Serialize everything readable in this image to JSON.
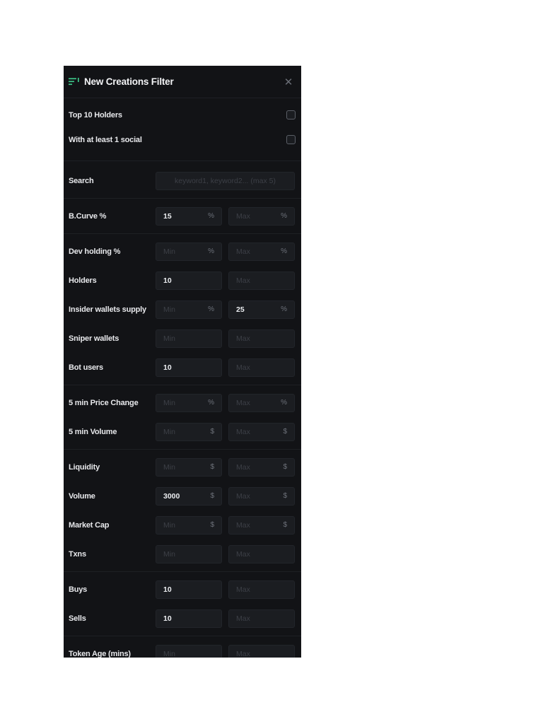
{
  "header": {
    "title": "New Creations Filter",
    "icon": "filter-lines-icon",
    "close_symbol": "✕",
    "accent": "#3ecf8e"
  },
  "checkboxes": [
    {
      "label": "Top 10 Holders",
      "checked": false
    },
    {
      "label": "With at least 1 social",
      "checked": false
    }
  ],
  "search": {
    "label": "Search",
    "placeholder": "keyword1, keyword2... (max 5)"
  },
  "bcurve": {
    "label": "B.Curve %",
    "min": "15",
    "max_ph": "Max",
    "unit": "%"
  },
  "dev_holding": {
    "label": "Dev holding %",
    "min_ph": "Min",
    "max_ph": "Max",
    "unit": "%"
  },
  "holders": {
    "label": "Holders",
    "min": "10",
    "max_ph": "Max"
  },
  "insider": {
    "label": "Insider wallets supply",
    "min_ph": "Min",
    "max": "25",
    "unit": "%"
  },
  "sniper": {
    "label": "Sniper wallets",
    "min_ph": "Min",
    "max_ph": "Max"
  },
  "bot_users": {
    "label": "Bot users",
    "min": "10",
    "max_ph": "Max"
  },
  "price_change": {
    "label": "5 min Price Change",
    "min_ph": "Min",
    "max_ph": "Max",
    "unit": "%"
  },
  "volume_5m": {
    "label": "5 min Volume",
    "min_ph": "Min",
    "max_ph": "Max",
    "unit": "$"
  },
  "liquidity": {
    "label": "Liquidity",
    "min_ph": "Min",
    "max_ph": "Max",
    "unit": "$"
  },
  "volume": {
    "label": "Volume",
    "min": "3000",
    "max_ph": "Max",
    "unit": "$"
  },
  "market_cap": {
    "label": "Market Cap",
    "min_ph": "Min",
    "max_ph": "Max",
    "unit": "$"
  },
  "txns": {
    "label": "Txns",
    "min_ph": "Min",
    "max_ph": "Max"
  },
  "buys": {
    "label": "Buys",
    "min": "10",
    "max_ph": "Max"
  },
  "sells": {
    "label": "Sells",
    "min": "10",
    "max_ph": "Max"
  },
  "token_age": {
    "label": "Token Age (mins)",
    "min_ph": "Min",
    "max_ph": "Max"
  }
}
